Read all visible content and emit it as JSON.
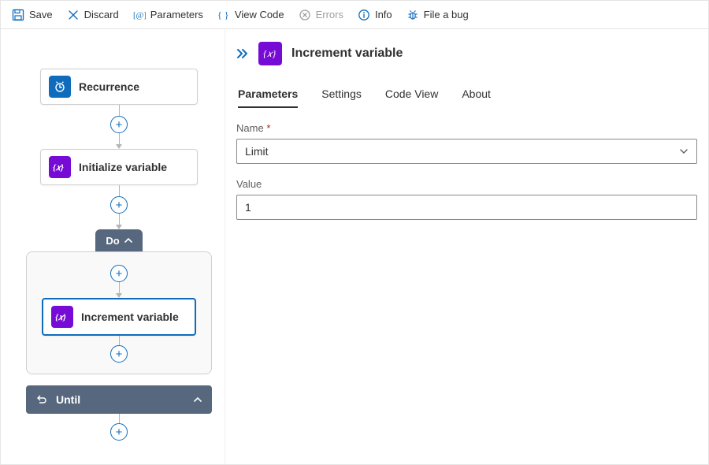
{
  "toolbar": {
    "save": "Save",
    "discard": "Discard",
    "parameters": "Parameters",
    "viewcode": "View Code",
    "errors": "Errors",
    "info": "Info",
    "filebug": "File a bug"
  },
  "canvas": {
    "recurrence": "Recurrence",
    "init": "Initialize variable",
    "do": "Do",
    "increment": "Increment variable",
    "until": "Until"
  },
  "panel": {
    "title": "Increment variable",
    "tabs": {
      "parameters": "Parameters",
      "settings": "Settings",
      "codeview": "Code View",
      "about": "About"
    },
    "name_label": "Name",
    "name_value": "Limit",
    "value_label": "Value",
    "value_value": "1"
  }
}
